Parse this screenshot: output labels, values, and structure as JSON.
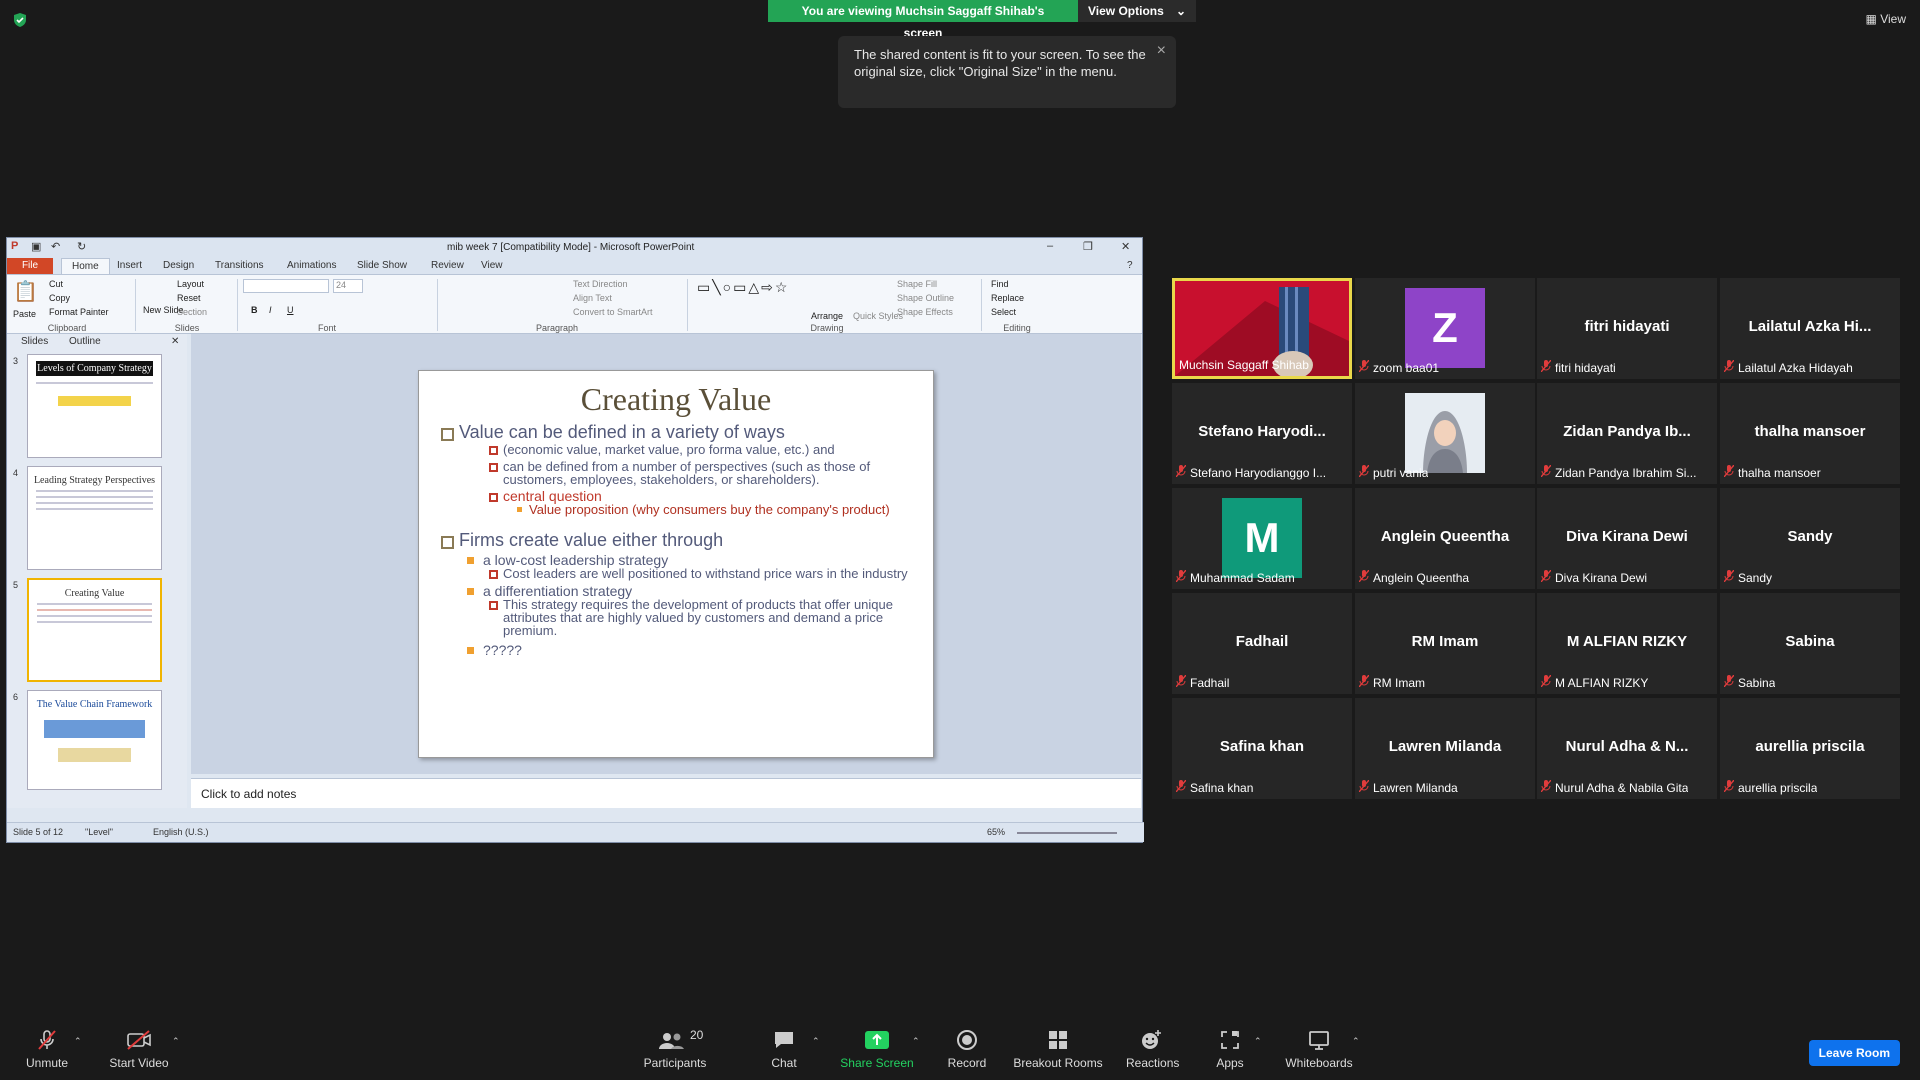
{
  "banner": {
    "viewing": "You are viewing Muchsin Saggaff Shihab's screen",
    "view_options": "View Options",
    "view_top": "View"
  },
  "tooltip": {
    "text": "The shared content is fit to your screen. To see the original size, click \"Original Size\" in the menu.",
    "close": "×"
  },
  "ppt": {
    "title": "mib week 7 [Compatibility Mode] - Microsoft PowerPoint",
    "tabs": [
      "File",
      "Home",
      "Insert",
      "Design",
      "Transitions",
      "Animations",
      "Slide Show",
      "Review",
      "View"
    ],
    "ribbon": {
      "clipboard": {
        "paste": "Paste",
        "cut": "Cut",
        "copy": "Copy",
        "format_painter": "Format Painter",
        "group": "Clipboard"
      },
      "slides": {
        "new_slide": "New Slide",
        "layout": "Layout",
        "reset": "Reset",
        "section": "Section",
        "group": "Slides"
      },
      "font": {
        "size": "24",
        "group": "Font"
      },
      "paragraph": {
        "text_direction": "Text Direction",
        "align_text": "Align Text",
        "convert": "Convert to SmartArt",
        "group": "Paragraph"
      },
      "drawing": {
        "arrange": "Arrange",
        "quick_styles": "Quick Styles",
        "shape_fill": "Shape Fill",
        "shape_outline": "Shape Outline",
        "shape_effects": "Shape Effects",
        "group": "Drawing"
      },
      "editing": {
        "find": "Find",
        "replace": "Replace",
        "select": "Select",
        "group": "Editing"
      }
    },
    "panel_tabs": {
      "slides": "Slides",
      "outline": "Outline"
    },
    "thumbs": [
      {
        "num": "3",
        "title": "Levels of Company Strategy"
      },
      {
        "num": "4",
        "title": "Leading Strategy Perspectives"
      },
      {
        "num": "5",
        "title": "Creating Value"
      },
      {
        "num": "6",
        "title": "The Value Chain Framework"
      }
    ],
    "slide": {
      "title": "Creating Value",
      "b1": "Value can be defined in a variety of ways",
      "b1a": "(economic value, market value, pro forma value, etc.) and",
      "b1b": "can be defined from a number of perspectives (such as those of customers, employees, stakeholders, or shareholders).",
      "b1c": "central question",
      "b1c1": "Value proposition (why consumers buy the company's product)",
      "b2": "Firms create value either through",
      "b2a": "a low-cost leadership strategy",
      "b2a1": "Cost leaders are well positioned to withstand price wars in the industry",
      "b2b": "a differentiation strategy",
      "b2b1": "This strategy requires the development of products that offer unique attributes that are highly valued by customers and demand a price premium.",
      "b2c": "?????"
    },
    "notes": "Click to add notes",
    "status": {
      "slide": "Slide 5 of 12",
      "theme": "\"Level\"",
      "lang": "English (U.S.)",
      "zoom": "65%"
    }
  },
  "participants": [
    {
      "name": "Muchsin Saggaff Shihab",
      "type": "video"
    },
    {
      "name": "zoom baa01",
      "type": "avatar",
      "initial": "Z",
      "color": "#8e44c8"
    },
    {
      "name": "fitri hidayati",
      "display": "fitri hidayati",
      "type": "name"
    },
    {
      "name": "Lailatul Azka Hidayah",
      "display": "Lailatul Azka Hi...",
      "type": "name"
    },
    {
      "name": "Stefano Haryodianggo I...",
      "display": "Stefano Haryodi...",
      "type": "name"
    },
    {
      "name": "putri vania",
      "type": "photo"
    },
    {
      "name": "Zidan Pandya Ibrahim Si...",
      "display": "Zidan Pandya Ib...",
      "type": "name"
    },
    {
      "name": "thalha mansoer",
      "display": "thalha mansoer",
      "type": "name"
    },
    {
      "name": "Muhammad Sadam",
      "type": "avatar",
      "initial": "M",
      "color": "#0f9a7a"
    },
    {
      "name": "Anglein Queentha",
      "display": "Anglein Queentha",
      "type": "name"
    },
    {
      "name": "Diva Kirana Dewi",
      "display": "Diva Kirana Dewi",
      "type": "name"
    },
    {
      "name": "Sandy",
      "display": "Sandy",
      "type": "name"
    },
    {
      "name": "Fadhail",
      "display": "Fadhail",
      "type": "name"
    },
    {
      "name": "RM Imam",
      "display": "RM Imam",
      "type": "name"
    },
    {
      "name": "M ALFIAN RIZKY",
      "display": "M ALFIAN RIZKY",
      "type": "name"
    },
    {
      "name": "Sabina",
      "display": "Sabina",
      "type": "name"
    },
    {
      "name": "Safina khan",
      "display": "Safina khan",
      "type": "name"
    },
    {
      "name": "Lawren Milanda",
      "display": "Lawren Milanda",
      "type": "name"
    },
    {
      "name": "Nurul Adha & Nabila Gita",
      "display": "Nurul Adha & N...",
      "type": "name"
    },
    {
      "name": "aurellia priscila",
      "display": "aurellia priscila",
      "type": "name"
    }
  ],
  "toolbar": {
    "unmute": "Unmute",
    "start_video": "Start Video",
    "participants": "Participants",
    "participants_count": "20",
    "chat": "Chat",
    "share_screen": "Share Screen",
    "record": "Record",
    "breakout": "Breakout Rooms",
    "reactions": "Reactions",
    "apps": "Apps",
    "whiteboards": "Whiteboards",
    "leave": "Leave Room"
  },
  "colors": {
    "green": "#23a455",
    "share_green": "#23d160",
    "leave_blue": "#0e72ed",
    "active_border": "#e9d84a"
  }
}
